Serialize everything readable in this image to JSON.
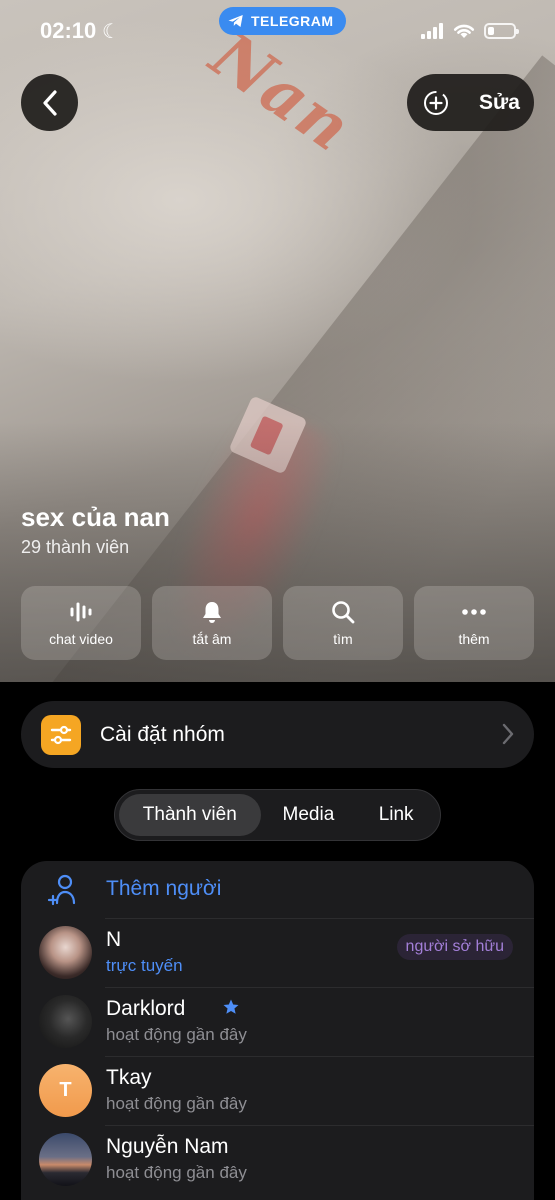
{
  "status_bar": {
    "time": "02:10",
    "telegram_label": "TELEGRAM"
  },
  "header": {
    "edit_label": "Sửa",
    "group_name": "sex của nan",
    "member_count": "29 thành viên",
    "photo_scribble": "Nan"
  },
  "actions": [
    {
      "icon": "voice-chat-icon",
      "label": "chat video"
    },
    {
      "icon": "bell-icon",
      "label": "tắt âm"
    },
    {
      "icon": "search-icon",
      "label": "tìm"
    },
    {
      "icon": "more-icon",
      "label": "thêm"
    }
  ],
  "settings": {
    "label": "Cài đặt nhóm",
    "icon_color": "#f5a623"
  },
  "tabs": [
    "Thành viên",
    "Media",
    "Link"
  ],
  "members": {
    "add_label": "Thêm người",
    "list": [
      {
        "name": "N",
        "status": "trực tuyến",
        "badge": "người sở hữu"
      },
      {
        "name": "Darklord",
        "status": "hoạt động gần đây"
      },
      {
        "name": "Tkay",
        "status": "hoạt động gần đây",
        "initial": "T"
      },
      {
        "name": "Nguyễn Nam",
        "status": "hoạt động gần đây"
      }
    ]
  },
  "colors": {
    "accent": "#4e8ef7",
    "telegram_blue": "#3a8bf0",
    "owner_badge_text": "#a37fd8",
    "panel": "#1c1c1e"
  }
}
